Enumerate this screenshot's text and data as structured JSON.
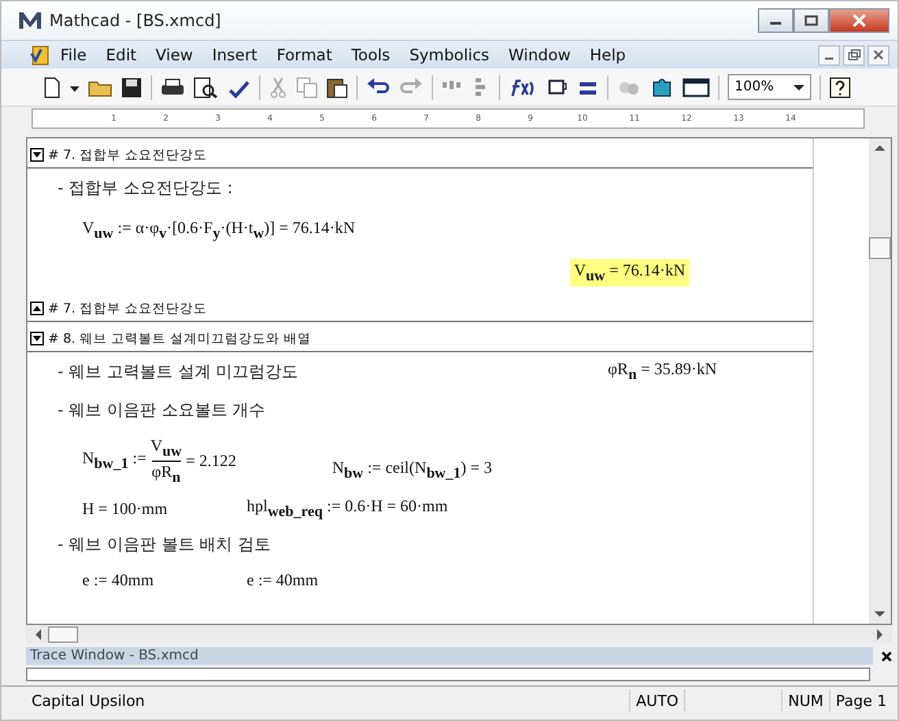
{
  "window": {
    "title": "Mathcad - [BS.xmcd]"
  },
  "menu": [
    "File",
    "Edit",
    "View",
    "Insert",
    "Format",
    "Tools",
    "Symbolics",
    "Window",
    "Help"
  ],
  "toolbar": {
    "zoom": "100%"
  },
  "ruler": [
    "1",
    "2",
    "3",
    "4",
    "5",
    "6",
    "7",
    "8",
    "9",
    "10",
    "11",
    "12",
    "13",
    "14"
  ],
  "document": [
    {
      "kind": "section",
      "expanded": true,
      "label": "# 7. 접합부 쇼요전단강도"
    },
    {
      "kind": "text",
      "text": "- 접합부 소요전단강도 :"
    },
    {
      "kind": "math",
      "text": "V$_{uw}$ := α·φ$_{v}$·[0.6·F$_{y}$·(H·t$_{w}$)] = 76.14·kN"
    },
    {
      "kind": "result",
      "text": "V$_{uw}$ = 76.14·kN"
    },
    {
      "kind": "section",
      "expanded": false,
      "label": "# 7. 접합부 쇼요전단강도"
    },
    {
      "kind": "section",
      "expanded": true,
      "label": "# 8. 웨브 고력볼트 설계미끄럼강도와 배열"
    },
    {
      "kind": "text_math",
      "text": "- 웨브 고력볼트 설계 미끄럼강도",
      "math": "φR$_{n}$ = 35.89·kN"
    },
    {
      "kind": "text",
      "text": "- 웨브 이음판 소요볼트 개수"
    },
    {
      "kind": "fraction_row",
      "lhs": "N$_{bw_1}$ :=",
      "numerator": "V$_{uw}$",
      "denominator": "φR$_{n}$",
      "result": "= 2.122",
      "math": "N$_{bw}$ := ceil(N$_{bw_1}$) = 3"
    },
    {
      "kind": "math_pair",
      "left": "H = 100·mm",
      "right": "hpl$_{web_req}$ := 0.6·H = 60·mm"
    },
    {
      "kind": "text",
      "text": "- 웨브 이음판 볼트 배치 검토"
    },
    {
      "kind": "math_pair",
      "left": "e := 40mm",
      "right": "e := 40mm"
    }
  ],
  "trace_window": {
    "title": "Trace Window - BS.xmcd"
  },
  "status_bar": [
    "Capital Upsilon",
    "AUTO",
    "NUM",
    "Page 1"
  ]
}
